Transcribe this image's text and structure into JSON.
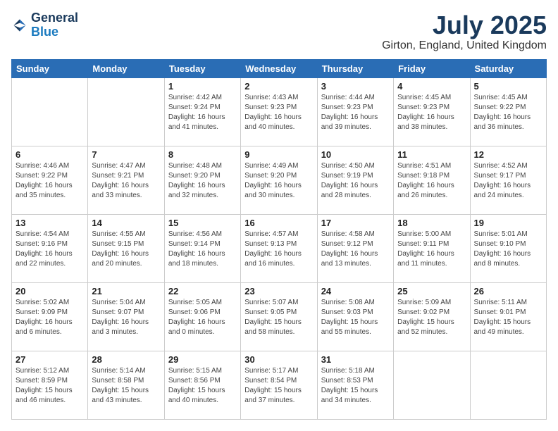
{
  "header": {
    "logo_line1": "General",
    "logo_line2": "Blue",
    "title": "July 2025",
    "subtitle": "Girton, England, United Kingdom"
  },
  "days_of_week": [
    "Sunday",
    "Monday",
    "Tuesday",
    "Wednesday",
    "Thursday",
    "Friday",
    "Saturday"
  ],
  "weeks": [
    [
      {
        "day": "",
        "info": ""
      },
      {
        "day": "",
        "info": ""
      },
      {
        "day": "1",
        "info": "Sunrise: 4:42 AM\nSunset: 9:24 PM\nDaylight: 16 hours\nand 41 minutes."
      },
      {
        "day": "2",
        "info": "Sunrise: 4:43 AM\nSunset: 9:23 PM\nDaylight: 16 hours\nand 40 minutes."
      },
      {
        "day": "3",
        "info": "Sunrise: 4:44 AM\nSunset: 9:23 PM\nDaylight: 16 hours\nand 39 minutes."
      },
      {
        "day": "4",
        "info": "Sunrise: 4:45 AM\nSunset: 9:23 PM\nDaylight: 16 hours\nand 38 minutes."
      },
      {
        "day": "5",
        "info": "Sunrise: 4:45 AM\nSunset: 9:22 PM\nDaylight: 16 hours\nand 36 minutes."
      }
    ],
    [
      {
        "day": "6",
        "info": "Sunrise: 4:46 AM\nSunset: 9:22 PM\nDaylight: 16 hours\nand 35 minutes."
      },
      {
        "day": "7",
        "info": "Sunrise: 4:47 AM\nSunset: 9:21 PM\nDaylight: 16 hours\nand 33 minutes."
      },
      {
        "day": "8",
        "info": "Sunrise: 4:48 AM\nSunset: 9:20 PM\nDaylight: 16 hours\nand 32 minutes."
      },
      {
        "day": "9",
        "info": "Sunrise: 4:49 AM\nSunset: 9:20 PM\nDaylight: 16 hours\nand 30 minutes."
      },
      {
        "day": "10",
        "info": "Sunrise: 4:50 AM\nSunset: 9:19 PM\nDaylight: 16 hours\nand 28 minutes."
      },
      {
        "day": "11",
        "info": "Sunrise: 4:51 AM\nSunset: 9:18 PM\nDaylight: 16 hours\nand 26 minutes."
      },
      {
        "day": "12",
        "info": "Sunrise: 4:52 AM\nSunset: 9:17 PM\nDaylight: 16 hours\nand 24 minutes."
      }
    ],
    [
      {
        "day": "13",
        "info": "Sunrise: 4:54 AM\nSunset: 9:16 PM\nDaylight: 16 hours\nand 22 minutes."
      },
      {
        "day": "14",
        "info": "Sunrise: 4:55 AM\nSunset: 9:15 PM\nDaylight: 16 hours\nand 20 minutes."
      },
      {
        "day": "15",
        "info": "Sunrise: 4:56 AM\nSunset: 9:14 PM\nDaylight: 16 hours\nand 18 minutes."
      },
      {
        "day": "16",
        "info": "Sunrise: 4:57 AM\nSunset: 9:13 PM\nDaylight: 16 hours\nand 16 minutes."
      },
      {
        "day": "17",
        "info": "Sunrise: 4:58 AM\nSunset: 9:12 PM\nDaylight: 16 hours\nand 13 minutes."
      },
      {
        "day": "18",
        "info": "Sunrise: 5:00 AM\nSunset: 9:11 PM\nDaylight: 16 hours\nand 11 minutes."
      },
      {
        "day": "19",
        "info": "Sunrise: 5:01 AM\nSunset: 9:10 PM\nDaylight: 16 hours\nand 8 minutes."
      }
    ],
    [
      {
        "day": "20",
        "info": "Sunrise: 5:02 AM\nSunset: 9:09 PM\nDaylight: 16 hours\nand 6 minutes."
      },
      {
        "day": "21",
        "info": "Sunrise: 5:04 AM\nSunset: 9:07 PM\nDaylight: 16 hours\nand 3 minutes."
      },
      {
        "day": "22",
        "info": "Sunrise: 5:05 AM\nSunset: 9:06 PM\nDaylight: 16 hours\nand 0 minutes."
      },
      {
        "day": "23",
        "info": "Sunrise: 5:07 AM\nSunset: 9:05 PM\nDaylight: 15 hours\nand 58 minutes."
      },
      {
        "day": "24",
        "info": "Sunrise: 5:08 AM\nSunset: 9:03 PM\nDaylight: 15 hours\nand 55 minutes."
      },
      {
        "day": "25",
        "info": "Sunrise: 5:09 AM\nSunset: 9:02 PM\nDaylight: 15 hours\nand 52 minutes."
      },
      {
        "day": "26",
        "info": "Sunrise: 5:11 AM\nSunset: 9:01 PM\nDaylight: 15 hours\nand 49 minutes."
      }
    ],
    [
      {
        "day": "27",
        "info": "Sunrise: 5:12 AM\nSunset: 8:59 PM\nDaylight: 15 hours\nand 46 minutes."
      },
      {
        "day": "28",
        "info": "Sunrise: 5:14 AM\nSunset: 8:58 PM\nDaylight: 15 hours\nand 43 minutes."
      },
      {
        "day": "29",
        "info": "Sunrise: 5:15 AM\nSunset: 8:56 PM\nDaylight: 15 hours\nand 40 minutes."
      },
      {
        "day": "30",
        "info": "Sunrise: 5:17 AM\nSunset: 8:54 PM\nDaylight: 15 hours\nand 37 minutes."
      },
      {
        "day": "31",
        "info": "Sunrise: 5:18 AM\nSunset: 8:53 PM\nDaylight: 15 hours\nand 34 minutes."
      },
      {
        "day": "",
        "info": ""
      },
      {
        "day": "",
        "info": ""
      }
    ]
  ]
}
